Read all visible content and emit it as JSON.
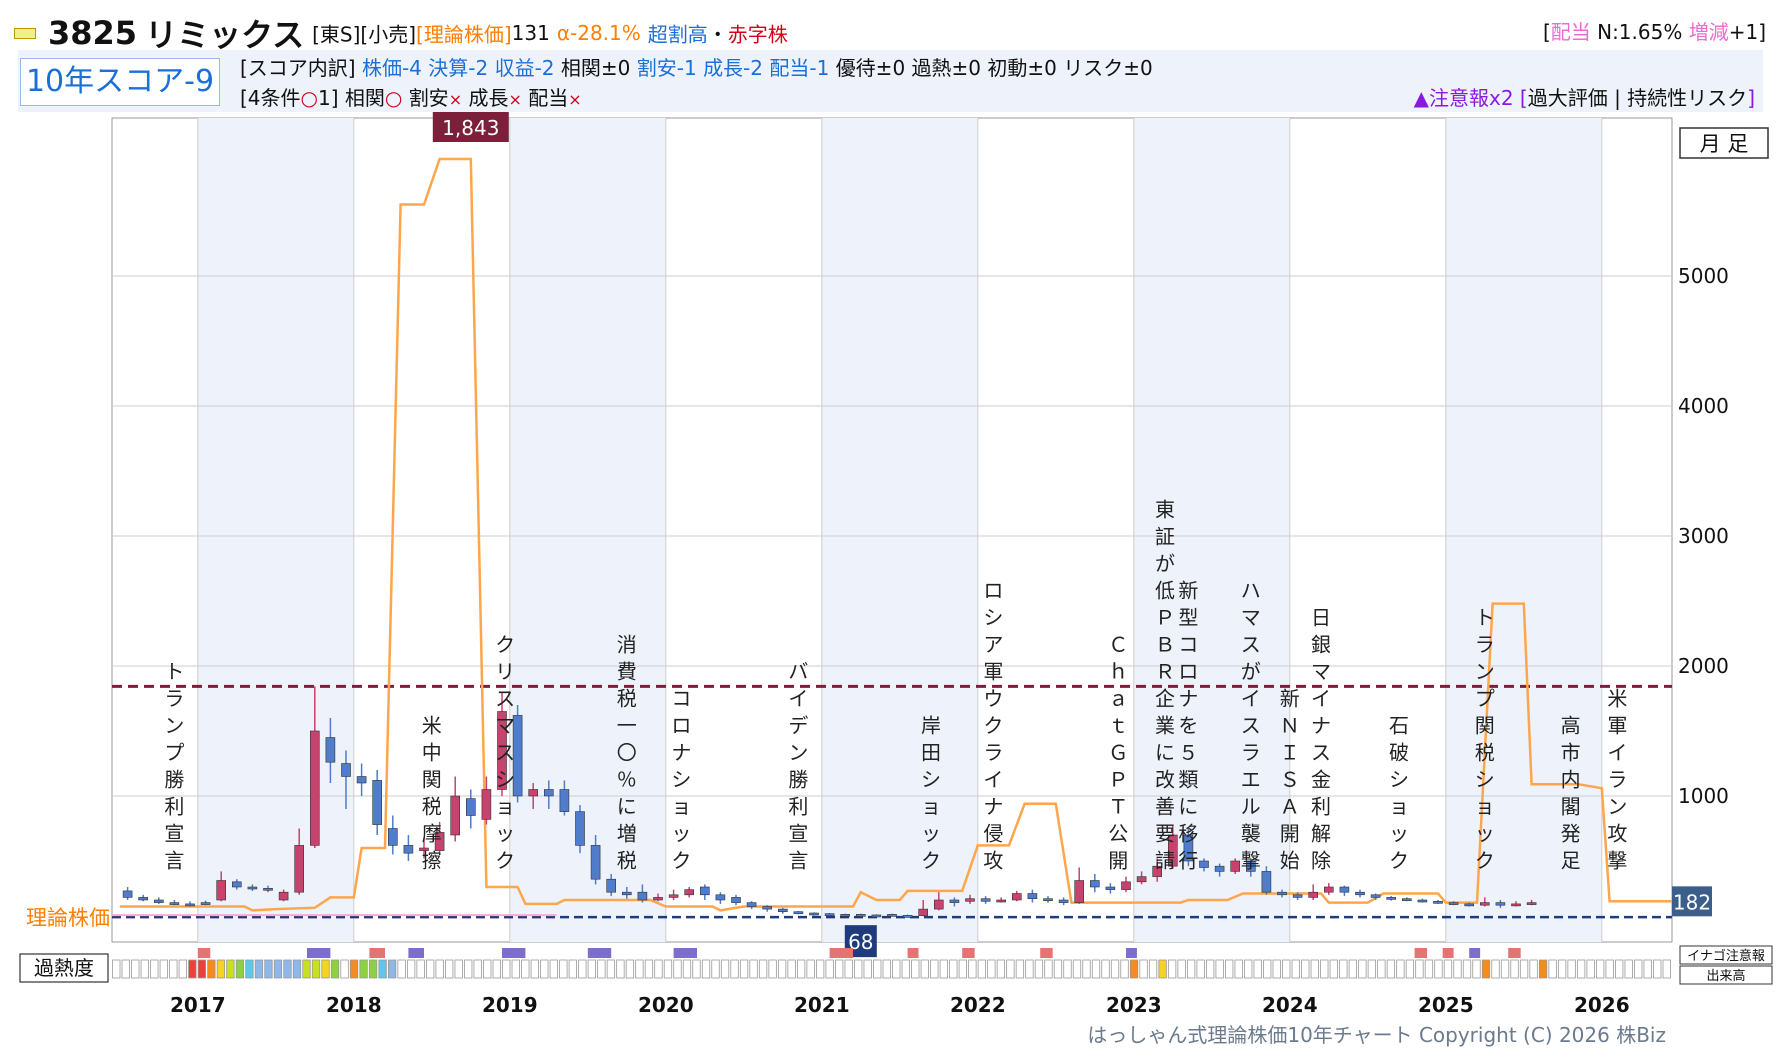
{
  "header": {
    "code": "3825",
    "name": "リミックス",
    "market": "[東S]",
    "industry": "[小売]",
    "theory_label": "[理論株価]",
    "theory_value": "131",
    "alpha": "α-28.1%",
    "valuation": "超割高",
    "sep": "・",
    "status": "赤字株",
    "right_open": "[",
    "dividend_label": "配当",
    "dividend_value": " N:1.65% ",
    "change_label": "増減",
    "change_value": "+1",
    "right_close": "]"
  },
  "score": {
    "label": "10年スコア-9",
    "breakdown_label": "[スコア内訳]",
    "items_blue": [
      "株価-4",
      "決算-2",
      "収益-2"
    ],
    "item_corr": "相関±0",
    "items_blue2": [
      "割安-1",
      "成長-2",
      "配当-1"
    ],
    "items_black": [
      "優待±0",
      "過熱±0",
      "初動±0",
      "リスク±0"
    ],
    "conditions_label": "[4条件",
    "conditions_mark": "○",
    "conditions_count": "1]",
    "cond_corr": "相関",
    "cond_corr_mark": "○",
    "cond_cheap": "割安",
    "cond_growth": "成長",
    "cond_div": "配当",
    "cross": "×",
    "warning": "▲注意報x2",
    "warning_detail_open": "[",
    "warning_detail": "過大評価 | 持続性リスク",
    "warning_detail_close": "]"
  },
  "chart_labels": {
    "period": "月 足",
    "theory_axis_label": "理論株価",
    "overheat_label": "過熱度",
    "inago_label": "イナゴ注意報",
    "volume_label": "出来高",
    "max_label": "1,843",
    "min_label": "68",
    "last_label": "182",
    "copyright": "はっしゃん式理論株価10年チャート Copyright (C) 2026 株Biz"
  },
  "colors": {
    "up": "#c8426e",
    "down": "#4f7ccb",
    "theory_line": "#ffa64d",
    "max_line": "#7b1f3b",
    "min_line": "#1f3b7b",
    "band": "#eef3fb"
  },
  "chart_data": {
    "type": "candlestick",
    "ylim": [
      0,
      6000
    ],
    "yticks": [
      1000,
      2000,
      3000,
      4000,
      5000
    ],
    "years": [
      "2017",
      "2018",
      "2019",
      "2020",
      "2021",
      "2022",
      "2023",
      "2024",
      "2025",
      "2026"
    ],
    "max_price": 1843,
    "min_price": 68,
    "last_price": 182,
    "events": [
      {
        "text": "トランプ勝利宣言",
        "date": 2016.85
      },
      {
        "text": "米中関税摩擦",
        "date": 2018.5
      },
      {
        "text": "クリスマスショック",
        "date": 2018.97
      },
      {
        "text": "消費税一〇％に増税",
        "date": 2019.75
      },
      {
        "text": "コロナショック",
        "date": 2020.1
      },
      {
        "text": "バイデン勝利宣言",
        "date": 2020.85
      },
      {
        "text": "岸田ショック",
        "date": 2021.7
      },
      {
        "text": "ロシア軍ウクライナ侵攻",
        "date": 2022.1
      },
      {
        "text": "ＣｈａｔＧＰＴ公開",
        "date": 2022.9
      },
      {
        "text": "東証が低ＰＢＲ企業に改善要請",
        "date": 2023.2
      },
      {
        "text": "新型コロナを５類に移行",
        "date": 2023.35
      },
      {
        "text": "ハマスがイスラエル襲撃",
        "date": 2023.75
      },
      {
        "text": "新ＮＩＳＡ開始",
        "date": 2024.0
      },
      {
        "text": "日銀マイナス金利解除",
        "date": 2024.2
      },
      {
        "text": "石破ショック",
        "date": 2024.7
      },
      {
        "text": "トランプ関税ショック",
        "date": 2025.25
      },
      {
        "text": "高市内閣発足",
        "date": 2025.8
      },
      {
        "text": "米軍イラン攻撃",
        "date": 2026.1
      }
    ],
    "theory_line": [
      [
        2016.5,
        150
      ],
      [
        2017.3,
        150
      ],
      [
        2017.35,
        120
      ],
      [
        2017.5,
        130
      ],
      [
        2017.75,
        140
      ],
      [
        2017.85,
        220
      ],
      [
        2018.0,
        220
      ],
      [
        2018.05,
        600
      ],
      [
        2018.2,
        600
      ],
      [
        2018.3,
        5550
      ],
      [
        2018.45,
        5550
      ],
      [
        2018.55,
        5900
      ],
      [
        2018.75,
        5900
      ],
      [
        2018.85,
        300
      ],
      [
        2019.05,
        300
      ],
      [
        2019.1,
        170
      ],
      [
        2019.3,
        170
      ],
      [
        2019.35,
        200
      ],
      [
        2019.9,
        200
      ],
      [
        2020.0,
        150
      ],
      [
        2020.3,
        150
      ],
      [
        2020.35,
        120
      ],
      [
        2020.5,
        150
      ],
      [
        2020.95,
        150
      ],
      [
        2021.0,
        150
      ],
      [
        2021.2,
        150
      ],
      [
        2021.25,
        260
      ],
      [
        2021.35,
        200
      ],
      [
        2021.5,
        200
      ],
      [
        2021.55,
        270
      ],
      [
        2021.9,
        270
      ],
      [
        2022.0,
        620
      ],
      [
        2022.2,
        620
      ],
      [
        2022.3,
        940
      ],
      [
        2022.5,
        940
      ],
      [
        2022.6,
        180
      ],
      [
        2023.1,
        180
      ],
      [
        2023.3,
        180
      ],
      [
        2023.35,
        200
      ],
      [
        2023.6,
        200
      ],
      [
        2023.7,
        250
      ],
      [
        2024.0,
        250
      ],
      [
        2024.2,
        250
      ],
      [
        2024.25,
        180
      ],
      [
        2024.5,
        180
      ],
      [
        2024.6,
        250
      ],
      [
        2024.95,
        250
      ],
      [
        2025.0,
        180
      ],
      [
        2025.2,
        180
      ],
      [
        2025.3,
        2480
      ],
      [
        2025.5,
        2480
      ],
      [
        2025.55,
        1090
      ],
      [
        2025.85,
        1090
      ],
      [
        2026.0,
        1060
      ],
      [
        2026.05,
        190
      ],
      [
        2026.45,
        190
      ]
    ],
    "candles": [
      [
        2016.55,
        270,
        220,
        300,
        200
      ],
      [
        2016.65,
        220,
        200,
        240,
        190
      ],
      [
        2016.75,
        200,
        180,
        220,
        170
      ],
      [
        2016.85,
        180,
        170,
        200,
        160
      ],
      [
        2016.95,
        170,
        160,
        190,
        150
      ],
      [
        2017.05,
        180,
        170,
        195,
        160
      ],
      [
        2017.15,
        200,
        350,
        420,
        190
      ],
      [
        2017.25,
        340,
        300,
        360,
        280
      ],
      [
        2017.35,
        300,
        290,
        320,
        270
      ],
      [
        2017.45,
        290,
        280,
        310,
        260
      ],
      [
        2017.55,
        200,
        260,
        280,
        190
      ],
      [
        2017.65,
        260,
        620,
        750,
        240
      ],
      [
        2017.75,
        620,
        1500,
        1843,
        600
      ],
      [
        2017.85,
        1450,
        1260,
        1600,
        1100
      ],
      [
        2017.95,
        1250,
        1150,
        1350,
        900
      ],
      [
        2018.05,
        1150,
        1100,
        1250,
        1000
      ],
      [
        2018.15,
        1120,
        780,
        1200,
        700
      ],
      [
        2018.25,
        750,
        620,
        850,
        550
      ],
      [
        2018.35,
        620,
        560,
        700,
        500
      ],
      [
        2018.45,
        580,
        600,
        680,
        520
      ],
      [
        2018.55,
        580,
        720,
        800,
        560
      ],
      [
        2018.65,
        700,
        1000,
        1150,
        650
      ],
      [
        2018.75,
        980,
        850,
        1050,
        750
      ],
      [
        2018.85,
        820,
        1050,
        1150,
        780
      ],
      [
        2018.95,
        1050,
        1650,
        1800,
        1000
      ],
      [
        2019.05,
        1620,
        1000,
        1700,
        950
      ],
      [
        2019.15,
        1000,
        1050,
        1100,
        900
      ],
      [
        2019.25,
        1050,
        1000,
        1120,
        900
      ],
      [
        2019.35,
        1050,
        880,
        1120,
        850
      ],
      [
        2019.45,
        880,
        620,
        930,
        560
      ],
      [
        2019.55,
        620,
        360,
        700,
        320
      ],
      [
        2019.65,
        360,
        260,
        400,
        230
      ],
      [
        2019.75,
        260,
        240,
        300,
        210
      ],
      [
        2019.85,
        260,
        200,
        320,
        180
      ],
      [
        2019.95,
        200,
        220,
        250,
        190
      ],
      [
        2020.05,
        220,
        240,
        280,
        200
      ],
      [
        2020.15,
        240,
        280,
        300,
        220
      ],
      [
        2020.25,
        300,
        240,
        320,
        200
      ],
      [
        2020.35,
        240,
        200,
        260,
        170
      ],
      [
        2020.45,
        220,
        180,
        240,
        160
      ],
      [
        2020.55,
        180,
        150,
        190,
        130
      ],
      [
        2020.65,
        150,
        130,
        160,
        110
      ],
      [
        2020.75,
        130,
        110,
        140,
        95
      ],
      [
        2020.85,
        110,
        100,
        115,
        90
      ],
      [
        2020.95,
        100,
        90,
        105,
        80
      ],
      [
        2021.05,
        95,
        90,
        100,
        80
      ],
      [
        2021.15,
        90,
        85,
        95,
        75
      ],
      [
        2021.25,
        90,
        80,
        95,
        70
      ],
      [
        2021.35,
        85,
        80,
        90,
        70
      ],
      [
        2021.45,
        90,
        80,
        95,
        72
      ],
      [
        2021.55,
        82,
        75,
        88,
        68
      ],
      [
        2021.65,
        80,
        130,
        200,
        75
      ],
      [
        2021.75,
        130,
        200,
        260,
        120
      ],
      [
        2021.85,
        200,
        180,
        220,
        150
      ],
      [
        2021.95,
        190,
        210,
        240,
        170
      ],
      [
        2022.05,
        210,
        190,
        230,
        170
      ],
      [
        2022.15,
        190,
        200,
        220,
        180
      ],
      [
        2022.25,
        200,
        250,
        270,
        190
      ],
      [
        2022.35,
        250,
        210,
        280,
        180
      ],
      [
        2022.45,
        210,
        200,
        230,
        180
      ],
      [
        2022.55,
        200,
        180,
        220,
        160
      ],
      [
        2022.65,
        180,
        350,
        450,
        170
      ],
      [
        2022.75,
        350,
        300,
        400,
        260
      ],
      [
        2022.85,
        300,
        280,
        330,
        250
      ],
      [
        2022.95,
        280,
        340,
        380,
        260
      ],
      [
        2023.05,
        340,
        380,
        420,
        320
      ],
      [
        2023.15,
        380,
        460,
        520,
        340
      ],
      [
        2023.25,
        460,
        700,
        780,
        440
      ],
      [
        2023.35,
        700,
        500,
        760,
        460
      ],
      [
        2023.45,
        500,
        450,
        520,
        420
      ],
      [
        2023.55,
        460,
        420,
        480,
        380
      ],
      [
        2023.65,
        420,
        500,
        520,
        400
      ],
      [
        2023.75,
        500,
        420,
        520,
        380
      ],
      [
        2023.85,
        420,
        260,
        460,
        240
      ],
      [
        2023.95,
        260,
        240,
        280,
        220
      ],
      [
        2024.05,
        240,
        220,
        260,
        200
      ],
      [
        2024.15,
        220,
        260,
        320,
        200
      ],
      [
        2024.25,
        260,
        300,
        330,
        240
      ],
      [
        2024.35,
        300,
        260,
        310,
        230
      ],
      [
        2024.45,
        260,
        240,
        280,
        220
      ],
      [
        2024.55,
        240,
        220,
        250,
        200
      ],
      [
        2024.65,
        220,
        210,
        230,
        195
      ],
      [
        2024.75,
        210,
        200,
        220,
        190
      ],
      [
        2024.85,
        200,
        190,
        210,
        180
      ],
      [
        2024.95,
        190,
        180,
        200,
        170
      ],
      [
        2025.05,
        180,
        170,
        190,
        160
      ],
      [
        2025.15,
        170,
        160,
        180,
        150
      ],
      [
        2025.25,
        160,
        180,
        220,
        150
      ],
      [
        2025.35,
        180,
        160,
        200,
        140
      ],
      [
        2025.45,
        160,
        170,
        190,
        150
      ],
      [
        2025.55,
        170,
        180,
        200,
        160
      ]
    ],
    "overheat_cells": [
      {
        "i": 8,
        "c": "#e8423b"
      },
      {
        "i": 9,
        "c": "#e8423b"
      },
      {
        "i": 10,
        "c": "#f58a1f"
      },
      {
        "i": 11,
        "c": "#f5d31f"
      },
      {
        "i": 12,
        "c": "#c9e01f"
      },
      {
        "i": 13,
        "c": "#8dd13f"
      },
      {
        "i": 14,
        "c": "#5ec7e6"
      },
      {
        "i": 15,
        "c": "#8fb8ea"
      },
      {
        "i": 16,
        "c": "#8fb8ea"
      },
      {
        "i": 17,
        "c": "#8fb8ea"
      },
      {
        "i": 18,
        "c": "#8fb8ea"
      },
      {
        "i": 19,
        "c": "#8fb8ea"
      },
      {
        "i": 20,
        "c": "#c9e01f"
      },
      {
        "i": 21,
        "c": "#c9e01f"
      },
      {
        "i": 22,
        "c": "#f5d31f"
      },
      {
        "i": 23,
        "c": "#8dd13f"
      },
      {
        "i": 25,
        "c": "#f58a1f"
      },
      {
        "i": 26,
        "c": "#8dd13f"
      },
      {
        "i": 27,
        "c": "#8dd13f"
      },
      {
        "i": 28,
        "c": "#5ec7e6"
      },
      {
        "i": 29,
        "c": "#8fb8ea"
      },
      {
        "i": 107,
        "c": "#f58a1f"
      },
      {
        "i": 110,
        "c": "#f5d31f"
      },
      {
        "i": 144,
        "c": "#f58a1f"
      },
      {
        "i": 150,
        "c": "#f58a1f"
      }
    ],
    "inago_marks": [
      {
        "start": 2017.0,
        "end": 2017.08,
        "c": "#e57373"
      },
      {
        "start": 2017.7,
        "end": 2017.85,
        "c": "#7c6fc9"
      },
      {
        "start": 2018.1,
        "end": 2018.2,
        "c": "#e57373"
      },
      {
        "start": 2018.35,
        "end": 2018.45,
        "c": "#7c6fc9"
      },
      {
        "start": 2018.95,
        "end": 2019.1,
        "c": "#7c6fc9"
      },
      {
        "start": 2019.5,
        "end": 2019.65,
        "c": "#7c6fc9"
      },
      {
        "start": 2020.05,
        "end": 2020.2,
        "c": "#7c6fc9"
      },
      {
        "start": 2021.05,
        "end": 2021.2,
        "c": "#e57373"
      },
      {
        "start": 2021.55,
        "end": 2021.62,
        "c": "#e57373"
      },
      {
        "start": 2021.9,
        "end": 2021.98,
        "c": "#e57373"
      },
      {
        "start": 2022.4,
        "end": 2022.48,
        "c": "#e57373"
      },
      {
        "start": 2022.95,
        "end": 2023.02,
        "c": "#7c6fc9"
      },
      {
        "start": 2024.8,
        "end": 2024.88,
        "c": "#e57373"
      },
      {
        "start": 2024.98,
        "end": 2025.05,
        "c": "#e57373"
      },
      {
        "start": 2025.15,
        "end": 2025.22,
        "c": "#7c6fc9"
      },
      {
        "start": 2025.4,
        "end": 2025.48,
        "c": "#e57373"
      }
    ]
  }
}
